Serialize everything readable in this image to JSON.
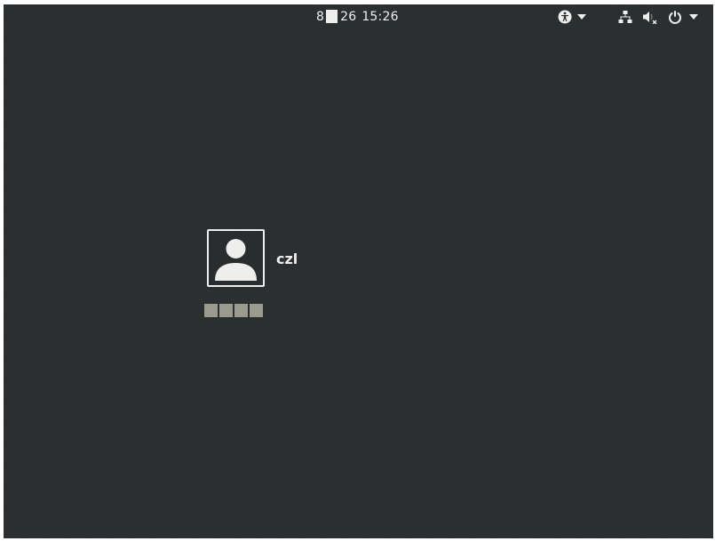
{
  "topbar": {
    "clock": {
      "day": "8",
      "date": "26",
      "time": "15:26"
    },
    "tray": {
      "icons": [
        "accessibility-icon",
        "network-icon",
        "volume-muted-icon",
        "power-icon"
      ]
    }
  },
  "login": {
    "username": "czl",
    "spinner_count": 4
  },
  "colors": {
    "background": "#2a2d2e",
    "foreground": "#eeeeec",
    "spinner": "#9a9a8e"
  }
}
